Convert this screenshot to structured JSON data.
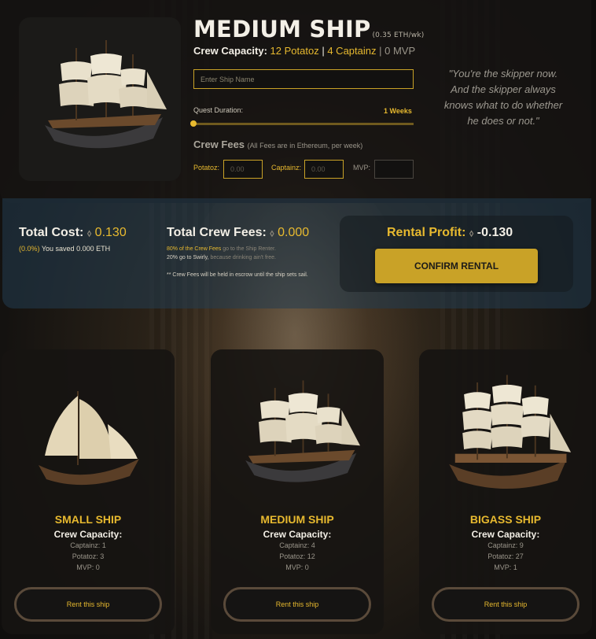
{
  "detail": {
    "title": "MEDIUM SHIP",
    "rate": "(0.35 ETH/wk)",
    "crew_capacity_label": "Crew Capacity:",
    "crew_potatoz": "12 Potatoz",
    "separator": "|",
    "crew_captainz": "4 Captainz",
    "crew_mvp": "0 MVP",
    "ship_name_placeholder": "Enter Ship Name",
    "quest_duration_label": "Quest Duration:",
    "quest_duration_value": "1 Weeks",
    "quest_duration_fraction": 0.0,
    "crew_fees_title": "Crew Fees",
    "crew_fees_note": "(All Fees are in Ethereum, per week)",
    "fees": [
      {
        "label": "Potatoz:",
        "placeholder": "0.00"
      },
      {
        "label": "Captainz:",
        "placeholder": "0.00"
      },
      {
        "label": "MVP:",
        "placeholder": ""
      }
    ],
    "quote": "\"You're the skipper now. And the skipper always knows what to do whether he does or not.\""
  },
  "summary": {
    "total_cost_label": "Total Cost:",
    "total_cost_value": "0.130",
    "saved_pct": "(0.0%)",
    "saved_text": "You saved 0.000 ETH",
    "total_crew_label": "Total Crew Fees:",
    "total_crew_value": "0.000",
    "split_line1_hl": "80% of the Crew Fees",
    "split_line1_rest": "go to the Ship Renter.",
    "split_line2": "20% go to Swirly,",
    "split_line2_rest": "because drinking ain't free.",
    "escrow_note": "** Crew Fees will be held in escrow until the ship sets sail.",
    "rental_profit_label": "Rental Profit:",
    "rental_profit_value": "-0.130",
    "confirm_label": "CONFIRM RENTAL"
  },
  "ships": [
    {
      "name": "SMALL SHIP",
      "cap_title": "Crew Capacity:",
      "captainz": "Captainz: 1",
      "potatoz": "Potatoz: 3",
      "mvp": "MVP: 0",
      "button": "Rent this ship"
    },
    {
      "name": "MEDIUM SHIP",
      "cap_title": "Crew Capacity:",
      "captainz": "Captainz: 4",
      "potatoz": "Potatoz: 12",
      "mvp": "MVP: 0",
      "button": "Rent this ship"
    },
    {
      "name": "BIGASS SHIP",
      "cap_title": "Crew Capacity:",
      "captainz": "Captainz: 9",
      "potatoz": "Potatoz: 27",
      "mvp": "MVP: 1",
      "button": "Rent this ship"
    }
  ],
  "colors": {
    "accent": "#e7b92f",
    "band": "#233c50",
    "card": "#161412"
  },
  "icons": {
    "currency": "ethereum-icon",
    "ship": "galleon-ship-icon"
  }
}
